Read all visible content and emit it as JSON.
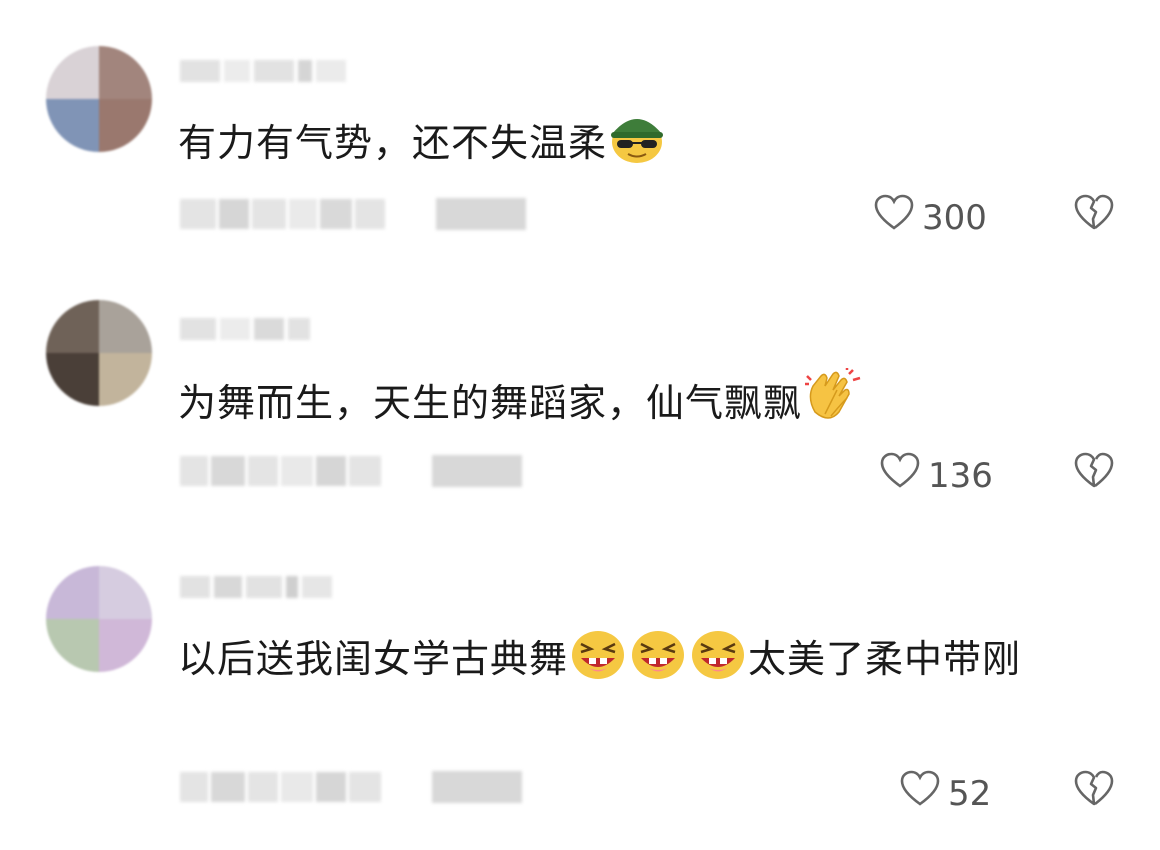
{
  "comments": [
    {
      "text": "有力有气势，还不失温柔",
      "emoji": "sunglasses-helmet-emoji",
      "likes": "300",
      "dislike_icon": "broken-heart-icon"
    },
    {
      "text": "为舞而生，天生的舞蹈家，仙气飘飘",
      "emoji": "clapping-hands-emoji",
      "likes": "136",
      "dislike_icon": "broken-heart-icon"
    },
    {
      "text_part1": "以后送我闺女学古典舞",
      "emoji": "laughing-face-emoji",
      "text_part2": "太美了柔中带刚",
      "likes": "52",
      "dislike_icon": "broken-heart-icon"
    }
  ],
  "icons": {
    "like": "heart-outline-icon",
    "dislike": "broken-heart-outline-icon"
  },
  "colors": {
    "text": "#1a1a1a",
    "meta": "#555555"
  }
}
